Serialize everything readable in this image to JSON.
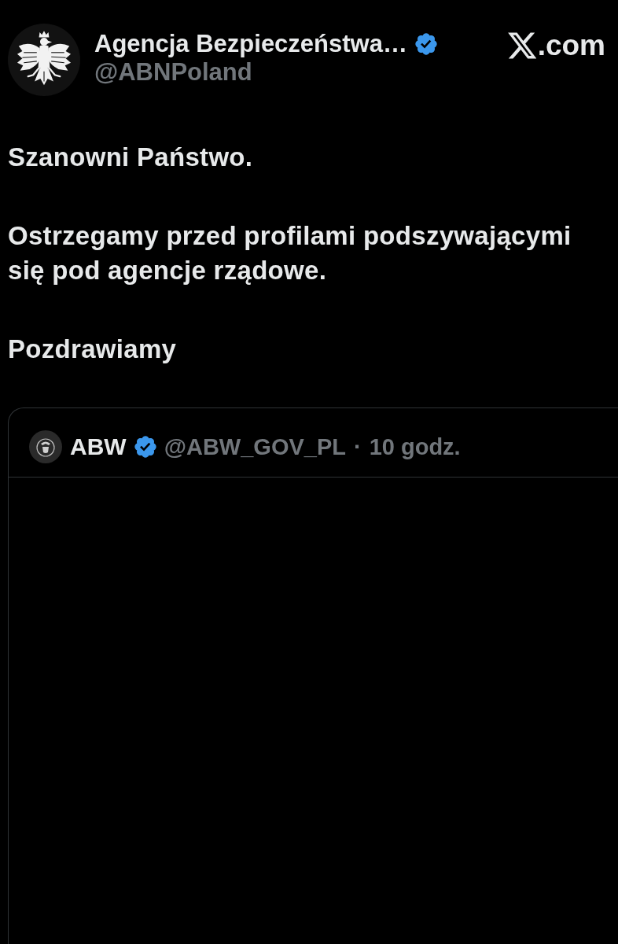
{
  "post": {
    "author": {
      "name": "Agencja Bezpieczeństwa…",
      "verified": true,
      "handle": "@ABNPoland"
    },
    "source": {
      "domain": ".com"
    },
    "paragraphs": [
      "Szanowni Państwo.",
      "Ostrzegamy przed profilami podszywającymi się pod agencje rządowe.",
      "Pozdrawiamy"
    ]
  },
  "quoted_post": {
    "author": {
      "name": "ABW",
      "verified": true,
      "handle": "@ABW_GOV_PL"
    },
    "separator": "·",
    "time": "10 godz."
  }
}
